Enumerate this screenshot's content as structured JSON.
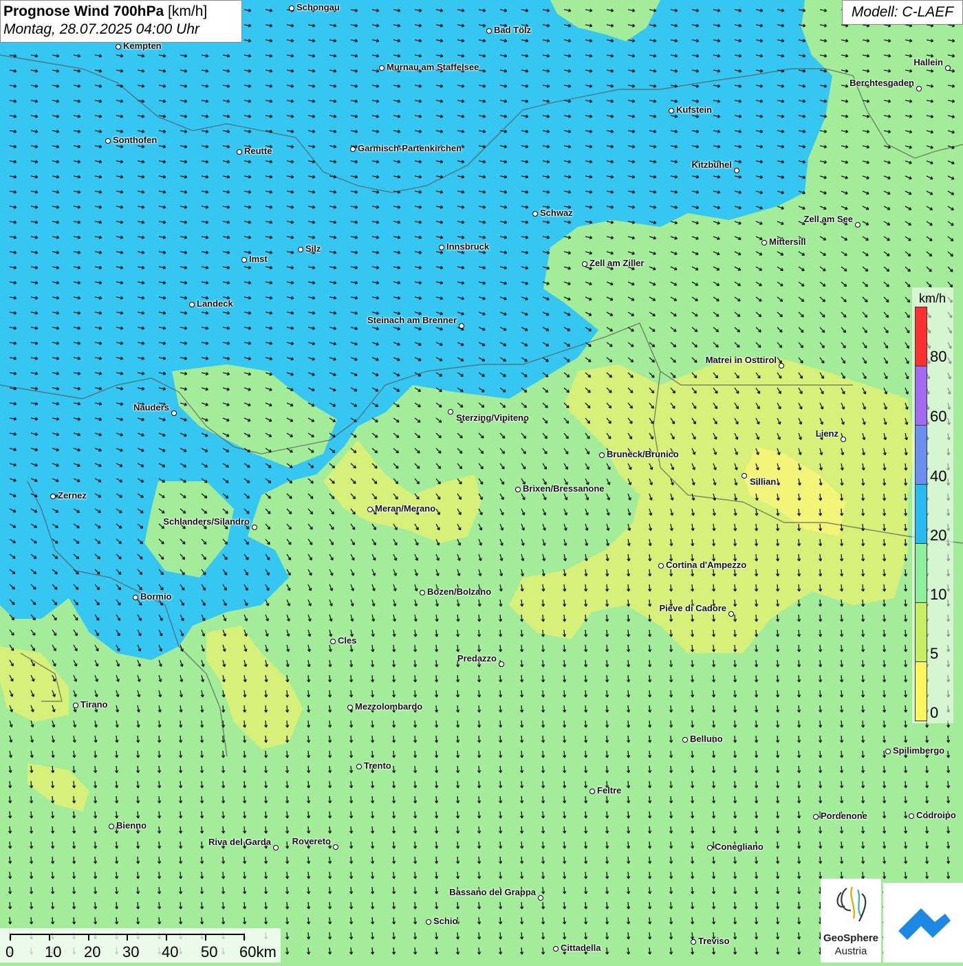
{
  "title": {
    "main_bold": "Prognose Wind 700hPa",
    "main_unit": "[km/h]",
    "subtitle": "Montag, 28.07.2025 04:00 Uhr"
  },
  "model": "Modell: C-LAEF",
  "legend": {
    "unit": "km/h",
    "labels": [
      "80",
      "60",
      "40",
      "20",
      "10",
      "5",
      "0"
    ],
    "colors": [
      "#ff3030",
      "#a36cf0",
      "#6a8ff0",
      "#27bbf0",
      "#8ef09a",
      "#c6f060",
      "#fff65c"
    ]
  },
  "scale": {
    "labels": [
      "0",
      "10",
      "20",
      "30",
      "40",
      "50",
      "60km"
    ]
  },
  "logos": {
    "geosphere_line1": "GeoSphere",
    "geosphere_line2": "Austria"
  },
  "colors": {
    "wind_20_40": "#35c6f2",
    "wind_10_20": "#a3ec9a",
    "wind_5_10": "#d6f07a"
  },
  "cities": [
    {
      "name": "Schongau"
    },
    {
      "name": "Bad Tölz"
    },
    {
      "name": "Kempten"
    },
    {
      "name": "Murnau am Staffelsee"
    },
    {
      "name": "Hallein"
    },
    {
      "name": "Berchtesgaden"
    },
    {
      "name": "Kufstein"
    },
    {
      "name": "Sonthofen"
    },
    {
      "name": "Reutte"
    },
    {
      "name": "Garmisch-Partenkirchen"
    },
    {
      "name": "Kitzbühel"
    },
    {
      "name": "Schwaz"
    },
    {
      "name": "Zell am See"
    },
    {
      "name": "Mittersill"
    },
    {
      "name": "Innsbruck"
    },
    {
      "name": "Silz"
    },
    {
      "name": "Imst"
    },
    {
      "name": "Zell am Ziller"
    },
    {
      "name": "Landeck"
    },
    {
      "name": "Steinach am Brenner"
    },
    {
      "name": "Matrei in Osttirol"
    },
    {
      "name": "Nauders"
    },
    {
      "name": "Sterzing/Vipiteno"
    },
    {
      "name": "Lienz"
    },
    {
      "name": "Bruneck/Brunico"
    },
    {
      "name": "Sillian"
    },
    {
      "name": "Zernez"
    },
    {
      "name": "Brixen/Bressanone"
    },
    {
      "name": "Meran/Merano"
    },
    {
      "name": "Schlanders/Silandro"
    },
    {
      "name": "Cortina d'Ampezzo"
    },
    {
      "name": "Bozen/Bolzano"
    },
    {
      "name": "Bormio"
    },
    {
      "name": "Pieve di Cadore"
    },
    {
      "name": "Cles"
    },
    {
      "name": "Predazzo"
    },
    {
      "name": "Tirano"
    },
    {
      "name": "Mezzolombardo"
    },
    {
      "name": "Belluno"
    },
    {
      "name": "Spilimbergo"
    },
    {
      "name": "Trento"
    },
    {
      "name": "Feltre"
    },
    {
      "name": "Pordenone"
    },
    {
      "name": "Codroipo"
    },
    {
      "name": "Bienno"
    },
    {
      "name": "Riva del Garda"
    },
    {
      "name": "Rovereto"
    },
    {
      "name": "Conegliano"
    },
    {
      "name": "Bassano del Grappa"
    },
    {
      "name": "Schio"
    },
    {
      "name": "Treviso"
    },
    {
      "name": "Cittadella"
    }
  ]
}
